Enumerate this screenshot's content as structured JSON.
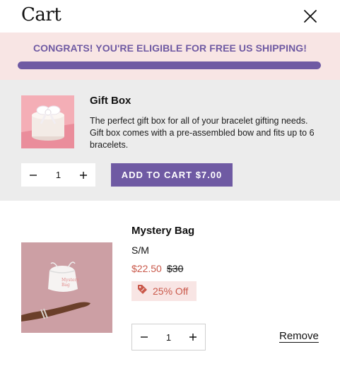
{
  "header": {
    "title": "Cart",
    "close_icon": "close-icon"
  },
  "banner": {
    "message": "CONGRATS! YOU'RE ELIGIBLE FOR FREE US SHIPPING!",
    "progress_fraction": 1.0,
    "accent": "#6f5aa3",
    "background": "#f8e5e4"
  },
  "upsell": {
    "name": "Gift Box",
    "description": "The perfect gift box for all of your bracelet gifting needs. Gift box comes with a pre-assembled bow and fits up to 6 bracelets.",
    "quantity": "1",
    "add_label": "ADD TO CART $7.00",
    "image_icon": "gift-box-image"
  },
  "cart_item": {
    "name": "Mystery Bag",
    "variant": "S/M",
    "price": "$22.50",
    "compare_price": "$30",
    "discount_label": "25% Off",
    "quantity": "1",
    "remove_label": "Remove",
    "image_icon": "mystery-bag-image",
    "price_color": "#c9584a"
  }
}
